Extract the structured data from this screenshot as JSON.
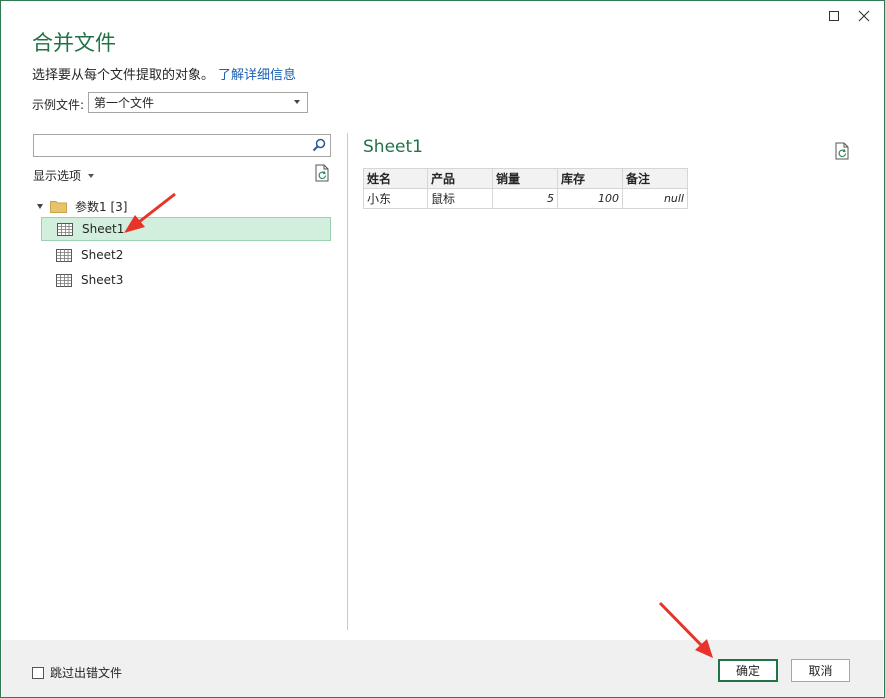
{
  "dialog": {
    "title": "合并文件",
    "subtitle": "选择要从每个文件提取的对象。",
    "learn_more": "了解详细信息",
    "example_label": "示例文件:",
    "example_value": "第一个文件"
  },
  "navigator": {
    "search_placeholder": "",
    "display_options": "显示选项",
    "root_label": "参数1 [3]",
    "items": [
      {
        "label": "Sheet1",
        "selected": true
      },
      {
        "label": "Sheet2",
        "selected": false
      },
      {
        "label": "Sheet3",
        "selected": false
      }
    ]
  },
  "preview": {
    "title": "Sheet1",
    "columns": [
      "姓名",
      "产品",
      "销量",
      "库存",
      "备注"
    ],
    "rows": [
      [
        "小东",
        "鼠标",
        "5",
        "100",
        "null"
      ]
    ]
  },
  "footer": {
    "skip_errors": "跳过出错文件",
    "ok": "确定",
    "cancel": "取消"
  },
  "colors": {
    "accent": "#217346",
    "selection_bg": "#d2eedc",
    "link": "#1a5fb4",
    "annotation_arrow": "#e8332a"
  },
  "icons": [
    "maximize-icon",
    "close-icon",
    "search-icon",
    "refresh-icon",
    "folder-icon",
    "sheet-icon"
  ]
}
